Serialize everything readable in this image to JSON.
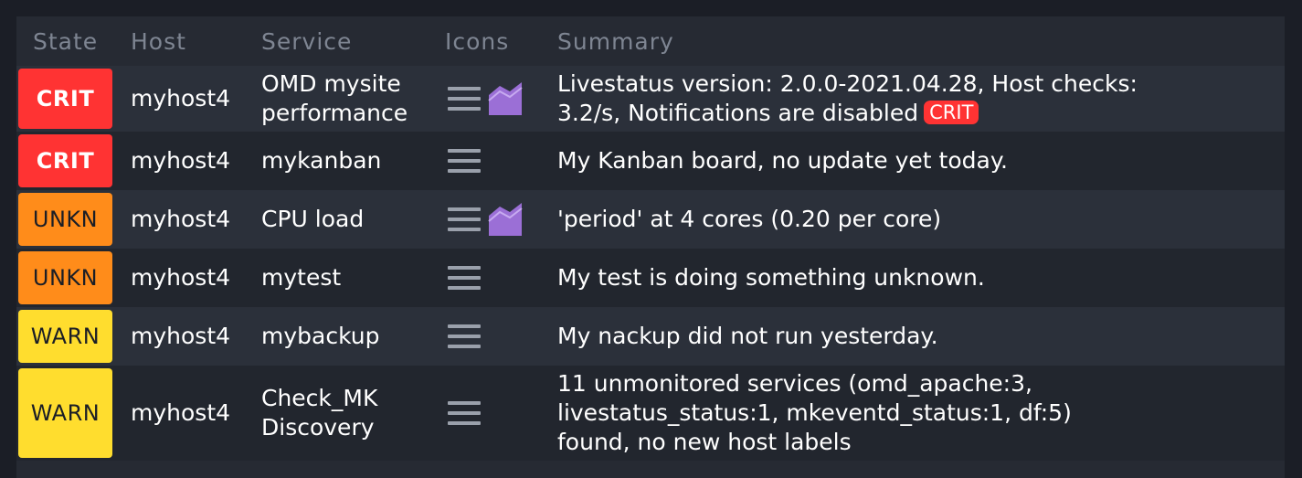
{
  "table": {
    "headers": {
      "state": "State",
      "host": "Host",
      "icons": "Icons",
      "service": "Service",
      "summary": "Summary"
    },
    "rows": [
      {
        "state": "CRIT",
        "host": "myhost4",
        "service_lines": [
          "OMD mysite",
          "performance"
        ],
        "icons": [
          "menu-icon",
          "graph-icon"
        ],
        "summary_lines": [
          "Livestatus version: 2.0.0-2021.04.28, Host checks:",
          "3.2/s, Notifications are disabled"
        ],
        "summary_badge": "CRIT"
      },
      {
        "state": "CRIT",
        "host": "myhost4",
        "service_lines": [
          "mykanban"
        ],
        "icons": [
          "menu-icon"
        ],
        "summary_lines": [
          "My Kanban board, no update yet today."
        ]
      },
      {
        "state": "UNKN",
        "host": "myhost4",
        "service_lines": [
          "CPU load"
        ],
        "icons": [
          "menu-icon",
          "graph-icon"
        ],
        "summary_lines": [
          "'period' at 4 cores (0.20 per core)"
        ]
      },
      {
        "state": "UNKN",
        "host": "myhost4",
        "service_lines": [
          "mytest"
        ],
        "icons": [
          "menu-icon"
        ],
        "summary_lines": [
          "My test is doing something unknown."
        ]
      },
      {
        "state": "WARN",
        "host": "myhost4",
        "service_lines": [
          "mybackup"
        ],
        "icons": [
          "menu-icon"
        ],
        "summary_lines": [
          "My nackup did not run yesterday."
        ]
      },
      {
        "state": "WARN",
        "host": "myhost4",
        "service_lines": [
          "Check_MK",
          "Discovery"
        ],
        "icons": [
          "menu-icon"
        ],
        "summary_lines": [
          "11 unmonitored services (omd_apache:3,",
          "livestatus_status:1, mkeventd_status:1, df:5)",
          "found, no new host labels"
        ]
      }
    ]
  },
  "colors": {
    "crit": "#ff3333",
    "unkn": "#ff8c1a",
    "warn": "#ffdd2e",
    "graph": "#9b6fd6"
  }
}
